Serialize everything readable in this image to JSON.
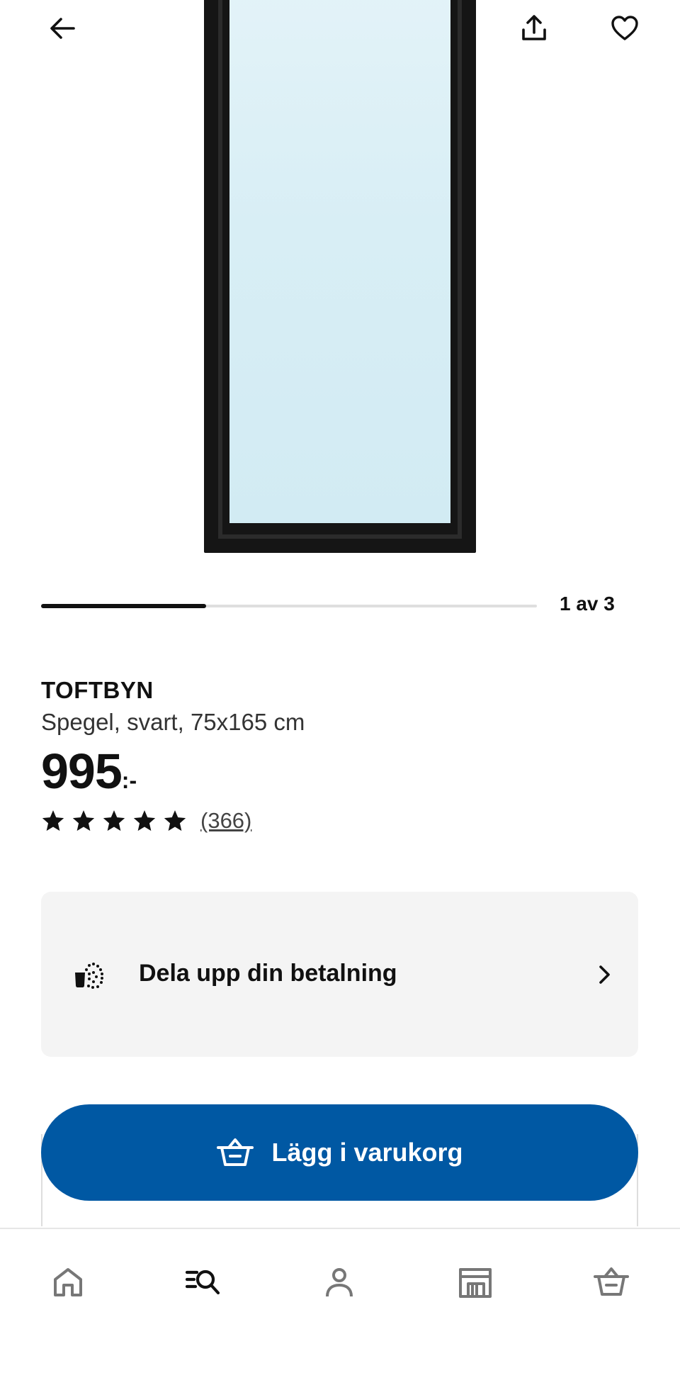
{
  "header": {
    "back_icon": "arrow-left-icon",
    "share_icon": "share-upload-icon",
    "favorite_icon": "heart-outline-icon"
  },
  "gallery": {
    "current": 1,
    "total": 3,
    "counter_label": "1 av 3"
  },
  "product": {
    "name": "TOFTBYN",
    "description": "Spegel, svart, 75x165 cm",
    "price_integer": "995",
    "price_suffix": ":-",
    "rating": {
      "stars": 5,
      "count_label": "(366)"
    }
  },
  "payment": {
    "label": "Dela upp din betalning",
    "icon": "split-payment-icon"
  },
  "cart_button": {
    "label": "Lägg i varukorg",
    "icon": "basket-add-icon"
  },
  "bottom_nav": {
    "items": [
      {
        "icon": "home-icon"
      },
      {
        "icon": "search-list-icon"
      },
      {
        "icon": "profile-icon"
      },
      {
        "icon": "store-icon"
      },
      {
        "icon": "basket-icon"
      }
    ]
  },
  "colors": {
    "primary_blue": "#0058a3",
    "text": "#111111",
    "card_bg": "#f4f4f4",
    "mirror_glass": "#d8eef5"
  }
}
